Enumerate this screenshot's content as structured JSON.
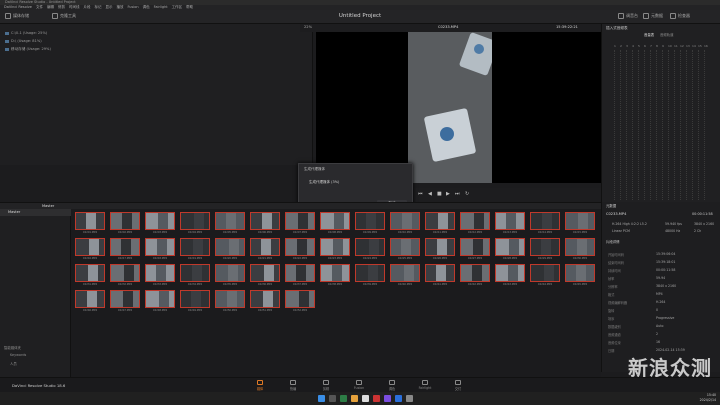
{
  "window": {
    "title": "DaVinci Resolve Studio - Untitled Project"
  },
  "menu": [
    "DaVinci Resolve",
    "文件",
    "编辑",
    "修剪",
    "时间线",
    "片段",
    "标记",
    "显示",
    "播放",
    "Fusion",
    "调色",
    "Fairlight",
    "工作区",
    "帮助"
  ],
  "toolbar": {
    "media_storage": "媒体存储",
    "clone_tool": "克隆工具",
    "project_title": "Untitled Project",
    "zoom": "22%",
    "clip_name": "C0233.MP4",
    "timecode": "15:39:22:21",
    "audio": "调音台",
    "metadata": "元数据",
    "inspector": "检查器"
  },
  "file_list": [
    "C:\\0-1 (Usage: 25%)",
    "D:\\ (Usage: 81%)",
    "移动存储 (Usage: 29%)"
  ],
  "inspector": {
    "title": "插入式音频表",
    "tabs": [
      "音量表",
      "音频轨道"
    ],
    "channels": [
      "1",
      "2",
      "3",
      "4",
      "5",
      "6",
      "7",
      "8",
      "9",
      "10",
      "11",
      "12",
      "13",
      "14",
      "15",
      "16"
    ]
  },
  "dialog": {
    "title": "生成代理媒体",
    "message": "生成代理媒体 (3%)",
    "button": "取消"
  },
  "media_pool": {
    "bar_label": "Master",
    "bin": "Master",
    "smart_bins": "智能媒体夹",
    "keywords": "Keywords",
    "people": "人员"
  },
  "clips": [
    "C0201.MP4",
    "C0202.MP4",
    "C0203.MP4",
    "C0204.MP4",
    "C0205.MP4",
    "C0206.MP4",
    "C0207.MP4",
    "C0208.MP4",
    "C0209.MP4",
    "C0210.MP4",
    "C0211.MP4",
    "C0212.MP4",
    "C0213.MP4",
    "C0214.MP4",
    "C0215.MP4",
    "C0216.MP4",
    "C0217.MP4",
    "C0218.MP4",
    "C0219.MP4",
    "C0220.MP4",
    "C0221.MP4",
    "C0222.MP4",
    "C0223.MP4",
    "C0224.MP4",
    "C0225.MP4",
    "C0226.MP4",
    "C0227.MP4",
    "C0228.MP4",
    "C0229.MP4",
    "C0230.MP4",
    "C0231.MP4",
    "C0232.MP4",
    "C0233.MP4",
    "C0234.MP4",
    "C0235.MP4",
    "C0236.MP4",
    "C0237.MP4",
    "C0238.MP4",
    "C0239.MP4",
    "C0240.MP4",
    "C0241.MP4",
    "C0242.MP4",
    "C0243.MP4",
    "C0244.MP4",
    "C0245.MP4",
    "C0246.MP4",
    "C0247.MP4",
    "C0248.MP4",
    "C0249.MP4",
    "C0250.MP4",
    "C0251.MP4",
    "C0252.MP4"
  ],
  "metadata_panel": {
    "header": "元数据",
    "clip": "C0233.MP4",
    "duration": "00:00:11:58",
    "codec": "H.264 High 4:2:2 L5.2",
    "fps": "59.940 fps",
    "res": "3840 x 2160",
    "audio": "Linear PCM",
    "rate": "48000 Hz",
    "ch": "2 Ch",
    "section": "片段详情",
    "rows": [
      {
        "k": "开始时间码",
        "v": "15:39:06:04"
      },
      {
        "k": "结束时间码",
        "v": "15:39:18:01"
      },
      {
        "k": "持续时间",
        "v": "00:00:11:58"
      },
      {
        "k": "帧率",
        "v": "59.94"
      },
      {
        "k": "分辨率",
        "v": "3840 x 2160"
      },
      {
        "k": "格式",
        "v": "MP4"
      },
      {
        "k": "视频编解码器",
        "v": "H.264"
      },
      {
        "k": "旋转",
        "v": "0"
      },
      {
        "k": "场序",
        "v": "Progressive"
      },
      {
        "k": "数据级别",
        "v": "Auto"
      },
      {
        "k": "音频通道",
        "v": "2"
      },
      {
        "k": "音频位深",
        "v": "16"
      },
      {
        "k": "日期",
        "v": "2024-02-14 15:39"
      }
    ]
  },
  "pages": [
    "媒体",
    "快编",
    "剪辑",
    "Fusion",
    "调色",
    "Fairlight",
    "交付"
  ],
  "brand": "DaVinci Resolve Studio 18.6",
  "clock": {
    "time": "15:40",
    "date": "2024/2/14"
  },
  "watermark": "新浪众测"
}
